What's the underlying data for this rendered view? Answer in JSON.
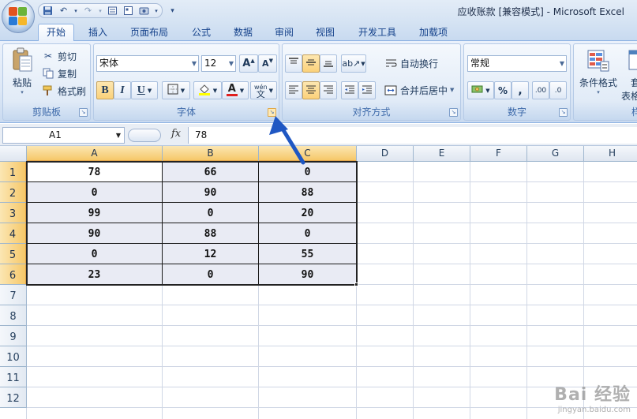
{
  "window": {
    "title": "应收账款  [兼容模式] - Microsoft Excel"
  },
  "tabs": [
    {
      "label": "开始",
      "active": true
    },
    {
      "label": "插入"
    },
    {
      "label": "页面布局"
    },
    {
      "label": "公式"
    },
    {
      "label": "数据"
    },
    {
      "label": "审阅"
    },
    {
      "label": "视图"
    },
    {
      "label": "开发工具"
    },
    {
      "label": "加载项"
    }
  ],
  "ribbon": {
    "clipboard": {
      "label": "剪贴板",
      "paste": "粘贴",
      "cut": "剪切",
      "copy": "复制",
      "format_painter": "格式刷"
    },
    "font": {
      "label": "字体",
      "font_name": "宋体",
      "font_size": "12",
      "bold": "B",
      "italic": "I",
      "underline": "U",
      "grow": "A",
      "shrink": "A",
      "font_color_glyph": "A",
      "wen": "wén"
    },
    "alignment": {
      "label": "对齐方式",
      "wrap_text": "自动换行",
      "merge_center": "合并后居中"
    },
    "number": {
      "label": "数字",
      "format": "常规",
      "percent": "%",
      "comma": ",",
      "inc_decimal": ".00",
      "dec_decimal": ".0"
    },
    "styles": {
      "label": "样",
      "conditional": "条件格式",
      "table_format_1": "套",
      "table_format_2": "表格"
    }
  },
  "formula_bar": {
    "name_box": "A1",
    "fx": "fx",
    "value": "78"
  },
  "sheet": {
    "columns": [
      "A",
      "B",
      "C",
      "D",
      "E",
      "F",
      "G",
      "H"
    ],
    "rows": [
      "1",
      "2",
      "3",
      "4",
      "5",
      "6",
      "7",
      "8",
      "9",
      "10",
      "11",
      "12"
    ],
    "cells": [
      [
        "78",
        "66",
        "0"
      ],
      [
        "0",
        "90",
        "88"
      ],
      [
        "99",
        "0",
        "20"
      ],
      [
        "90",
        "88",
        "0"
      ],
      [
        "0",
        "12",
        "55"
      ],
      [
        "23",
        "0",
        "90"
      ]
    ]
  },
  "watermark": {
    "main": "Bai 经验",
    "sub": "jingyan.baidu.com"
  },
  "colors": {
    "accent_arrow": "#1f57c3",
    "selection_fill": "#e9ebf4",
    "header_selected": "#f6c869"
  }
}
